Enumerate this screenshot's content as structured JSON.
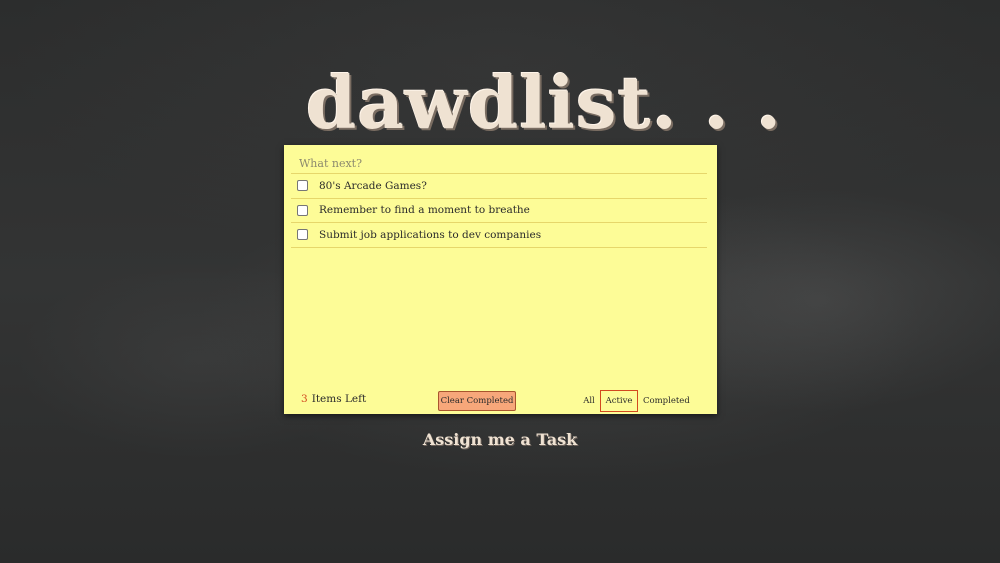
{
  "app": {
    "title": "dawdlist. . .",
    "subtitle": "Assign me a Task"
  },
  "input": {
    "placeholder": "What next?",
    "value": ""
  },
  "tasks": [
    {
      "label": "80's Arcade Games?",
      "completed": false
    },
    {
      "label": "Remember to find a moment to breathe",
      "completed": false
    },
    {
      "label": "Submit job applications to dev companies",
      "completed": false
    }
  ],
  "footer": {
    "count": "3",
    "items_left_label": "Items Left",
    "clear_label": "Clear Completed",
    "filters": {
      "all": "All",
      "active": "Active",
      "completed": "Completed"
    },
    "selected_filter": "Active"
  },
  "colors": {
    "background": "#2e2f2f",
    "note": "#fdfc97",
    "accent": "#d2491f",
    "button": "#f7a77a",
    "chalk": "#efe2d2"
  }
}
